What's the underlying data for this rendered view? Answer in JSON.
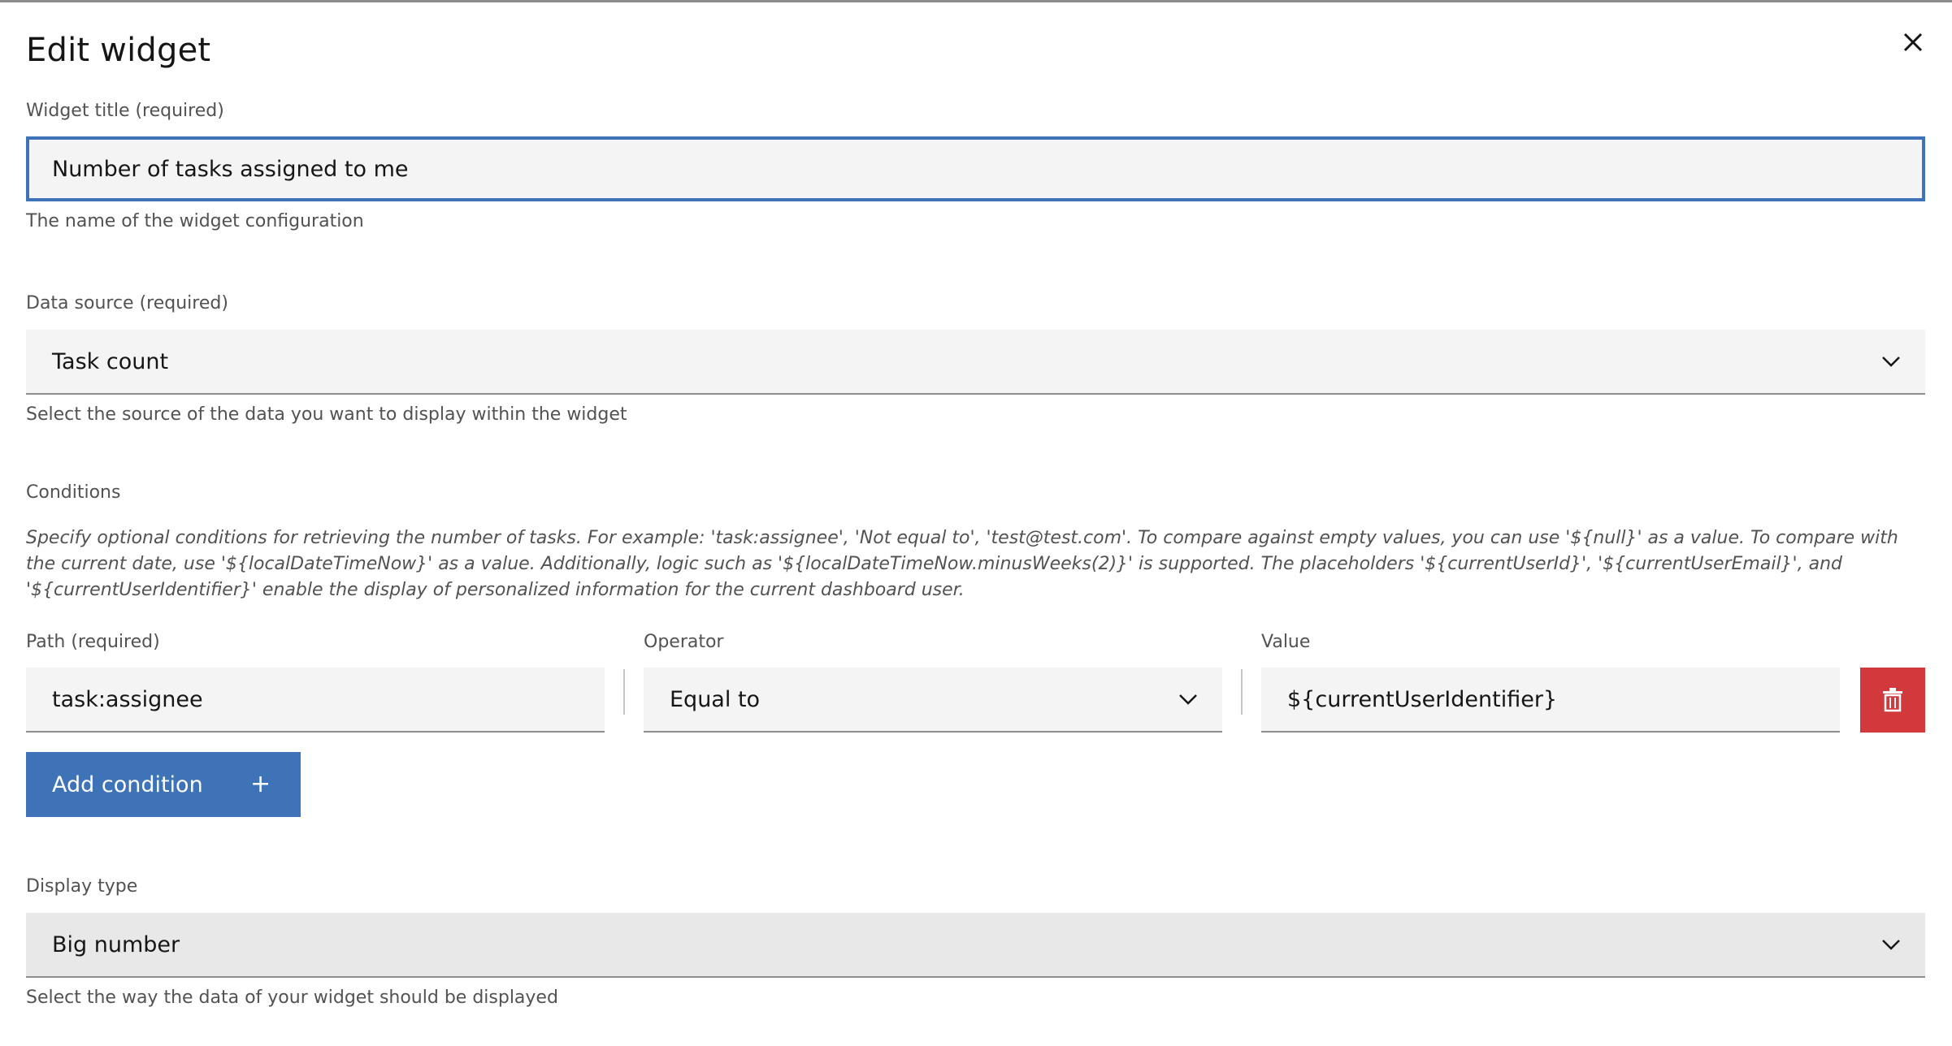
{
  "modal": {
    "title": "Edit widget",
    "close_icon": "close-icon"
  },
  "widget_title": {
    "label": "Widget title (required)",
    "value": "Number of tasks assigned to me",
    "helper": "The name of the widget configuration"
  },
  "data_source": {
    "label": "Data source (required)",
    "selected": "Task count",
    "helper": "Select the source of the data you want to display within the widget"
  },
  "conditions": {
    "label": "Conditions",
    "description": "Specify optional conditions for retrieving the number of tasks. For example: 'task:assignee', 'Not equal to', 'test@test.com'. To compare against empty values, you can use '${null}' as a value. To compare with the current date, use '${localDateTimeNow}' as a value. Additionally, logic such as '${localDateTimeNow.minusWeeks(2)}' is supported. The placeholders '${currentUserId}', '${currentUserEmail}', and '${currentUserIdentifier}' enable the display of personalized information for the current dashboard user.",
    "path_label": "Path (required)",
    "operator_label": "Operator",
    "value_label": "Value",
    "rows": [
      {
        "path": "task:assignee",
        "operator": "Equal to",
        "value": "${currentUserIdentifier}"
      }
    ],
    "add_button_label": "Add condition",
    "add_icon": "+"
  },
  "display_type": {
    "label": "Display type",
    "selected": "Big number",
    "helper": "Select the way the data of your widget should be displayed"
  },
  "colors": {
    "focus_border": "#3f73b8",
    "primary_button": "#3f73b8",
    "danger_button": "#d1393d",
    "field_bg": "#f4f4f4"
  }
}
